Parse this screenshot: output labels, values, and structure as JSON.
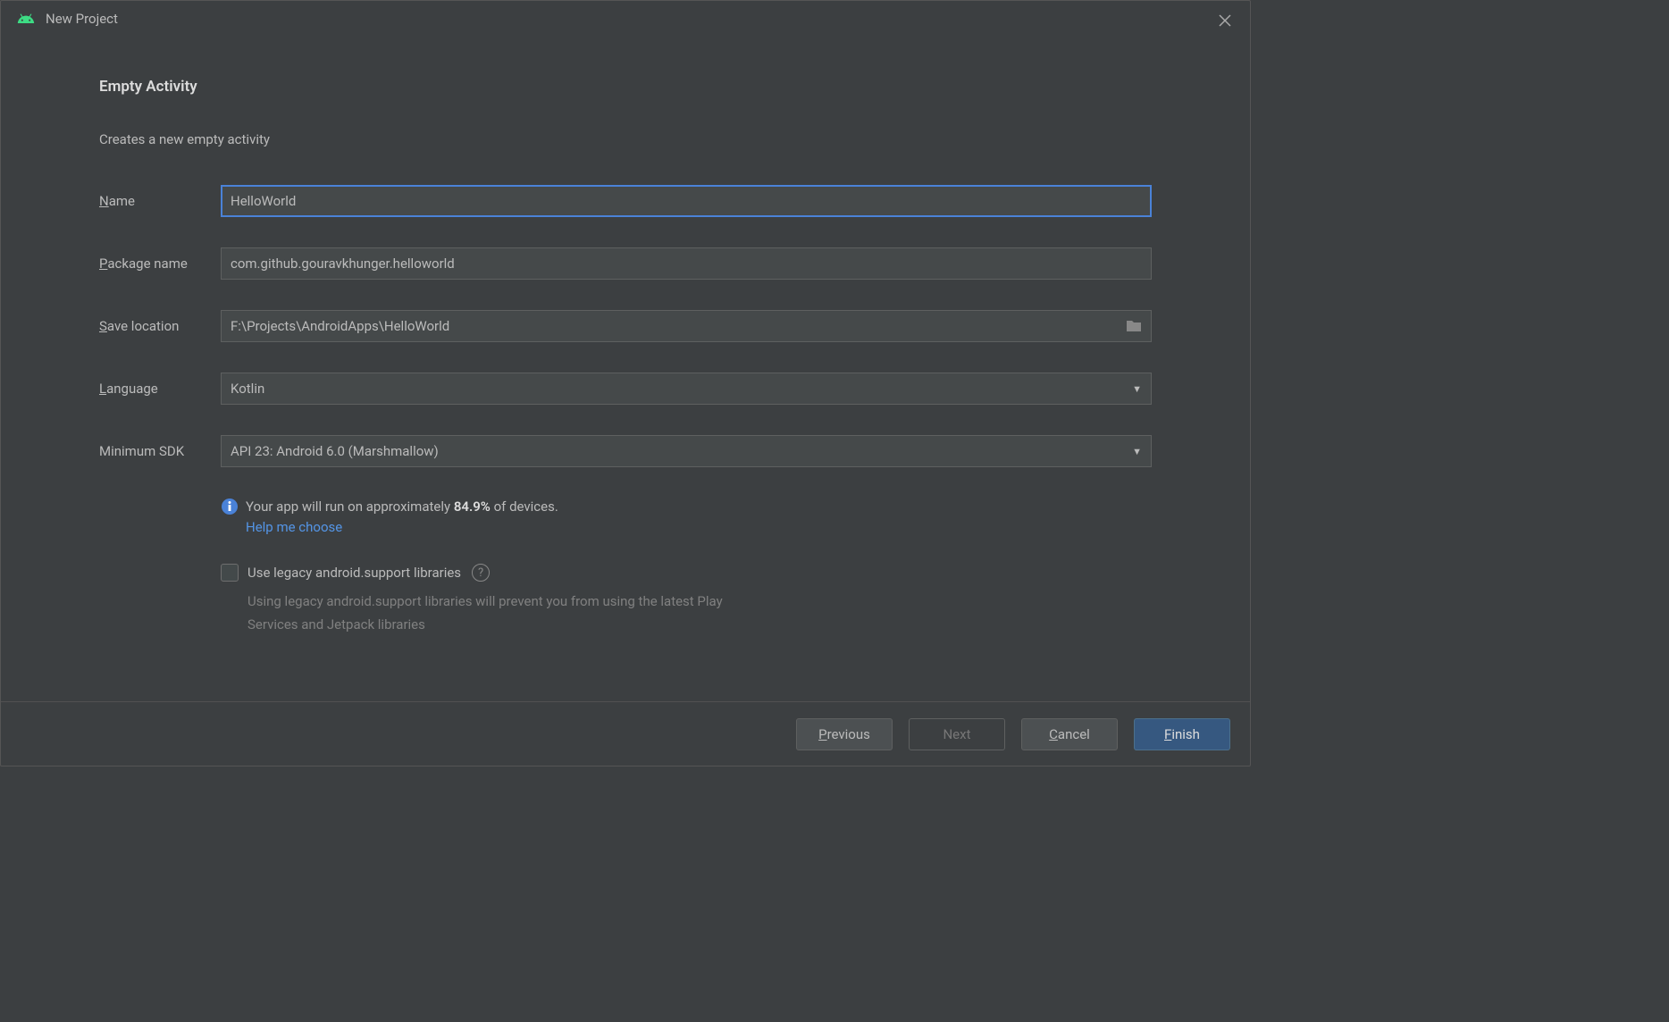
{
  "window": {
    "title": "New Project"
  },
  "header": {
    "title": "Empty Activity",
    "description": "Creates a new empty activity"
  },
  "form": {
    "name": {
      "label": "Name",
      "mnemonic": "N",
      "value": "HelloWorld"
    },
    "package": {
      "label": "Package name",
      "mnemonic": "P",
      "value": "com.github.gouravkhunger.helloworld"
    },
    "location": {
      "label": "Save location",
      "mnemonic": "S",
      "value": "F:\\Projects\\AndroidApps\\HelloWorld"
    },
    "language": {
      "label": "Language",
      "mnemonic": "L",
      "value": "Kotlin"
    },
    "minsdk": {
      "label": "Minimum SDK",
      "value": "API 23: Android 6.0 (Marshmallow)"
    }
  },
  "info": {
    "prefix": "Your app will run on approximately ",
    "percentage": "84.9%",
    "suffix": " of devices.",
    "help_link": "Help me choose"
  },
  "legacy": {
    "label": "Use legacy android.support libraries",
    "description": "Using legacy android.support libraries will prevent you from using the latest Play Services and Jetpack libraries"
  },
  "buttons": {
    "previous": "Previous",
    "next": "Next",
    "cancel": "Cancel",
    "finish": "Finish"
  }
}
